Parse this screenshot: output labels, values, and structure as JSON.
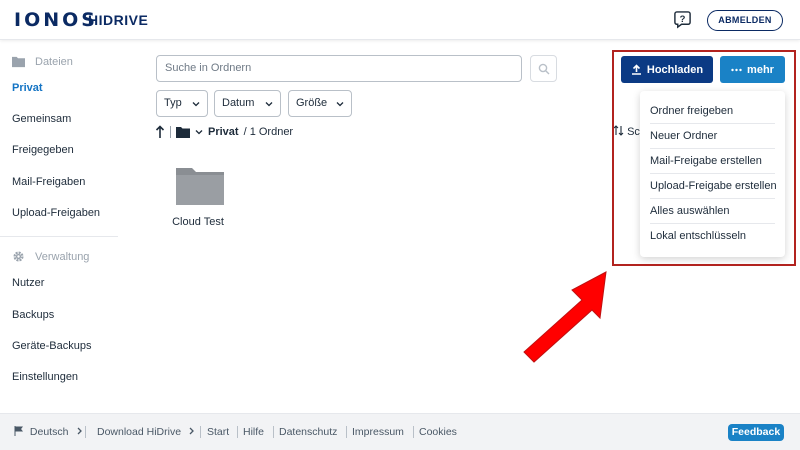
{
  "header": {
    "logo": "IONOS",
    "product": "HIDRIVE",
    "logout_label": "ABMELDEN"
  },
  "sidebar": {
    "files_section": "Dateien",
    "items_files": [
      {
        "label": "Privat",
        "active": true
      },
      {
        "label": "Gemeinsam"
      },
      {
        "label": "Freigegeben"
      },
      {
        "label": "Mail-Freigaben"
      },
      {
        "label": "Upload-Freigaben"
      }
    ],
    "admin_section": "Verwaltung",
    "items_admin": [
      {
        "label": "Nutzer"
      },
      {
        "label": "Backups"
      },
      {
        "label": "Geräte-Backups"
      },
      {
        "label": "Einstellungen"
      }
    ]
  },
  "search": {
    "placeholder": "Suche in Ordnern"
  },
  "filters": {
    "type": "Typ",
    "date": "Datum",
    "size": "Größe"
  },
  "breadcrumb": {
    "current": "Privat",
    "count": "/ 1 Ordner"
  },
  "sort_label": "Sc",
  "files": [
    {
      "name": "Cloud Test",
      "kind": "folder"
    }
  ],
  "actions": {
    "upload_label": "Hochladen",
    "more_label": "mehr"
  },
  "more_menu": [
    "Ordner freigeben",
    "Neuer Ordner",
    "Mail-Freigabe erstellen",
    "Upload-Freigabe erstellen",
    "Alles auswählen",
    "Lokal entschlüsseln"
  ],
  "footer": {
    "language": "Deutsch",
    "download": "Download HiDrive",
    "links": [
      "Start",
      "Hilfe",
      "Datenschutz",
      "Impressum",
      "Cookies"
    ],
    "feedback": "Feedback"
  },
  "colors": {
    "brand": "#0b2a63",
    "primary_button": "#0b3a84",
    "accent": "#1a82c6",
    "active_link": "#1474c4",
    "annotation": "#b2231f",
    "arrow": "#ff0000"
  }
}
